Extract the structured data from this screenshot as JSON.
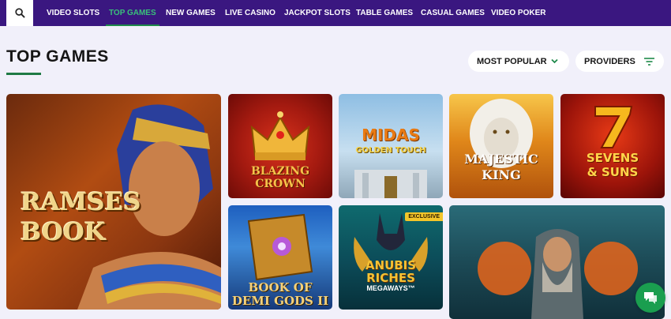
{
  "nav": {
    "search_icon": "search-icon",
    "items": [
      {
        "label": "VIDEO SLOTS",
        "active": false
      },
      {
        "label": "TOP GAMES",
        "active": true
      },
      {
        "label": "NEW GAMES",
        "active": false
      },
      {
        "label": "LIVE CASINO",
        "active": false
      },
      {
        "label": "JACKPOT SLOTS",
        "active": false
      },
      {
        "label": "TABLE GAMES",
        "active": false
      },
      {
        "label": "CASUAL GAMES",
        "active": false
      },
      {
        "label": "VIDEO POKER",
        "active": false
      }
    ]
  },
  "page": {
    "title": "TOP GAMES",
    "sort_label": "MOST POPULAR",
    "providers_label": "PROVIDERS"
  },
  "games": {
    "ramses": {
      "title_line1": "RAMSES",
      "title_line2": "BOOK"
    },
    "blazing": {
      "title_line1": "BLAZING",
      "title_line2": "CROWN"
    },
    "midas": {
      "title": "MIDAS",
      "subtitle": "GOLDEN TOUCH"
    },
    "majestic": {
      "title_line1": "MAJESTIC",
      "title_line2": "KING"
    },
    "sevens": {
      "title_line1": "SEVENS",
      "title_line2": "& SUNS"
    },
    "bookdemi": {
      "title_line1": "BOOK OF",
      "title_line2": "DEMI GODS II"
    },
    "anubis": {
      "title_line1": "ANUBIS",
      "title_line2": "RICHES",
      "subtitle": "MEGAWAYS™",
      "badge": "EXCLUSIVE"
    },
    "power": {}
  },
  "colors": {
    "nav_bg": "#3a1780",
    "accent_green": "#1f8a4a",
    "page_bg": "#f1f0fa",
    "chat_green": "#1a9e4f"
  }
}
